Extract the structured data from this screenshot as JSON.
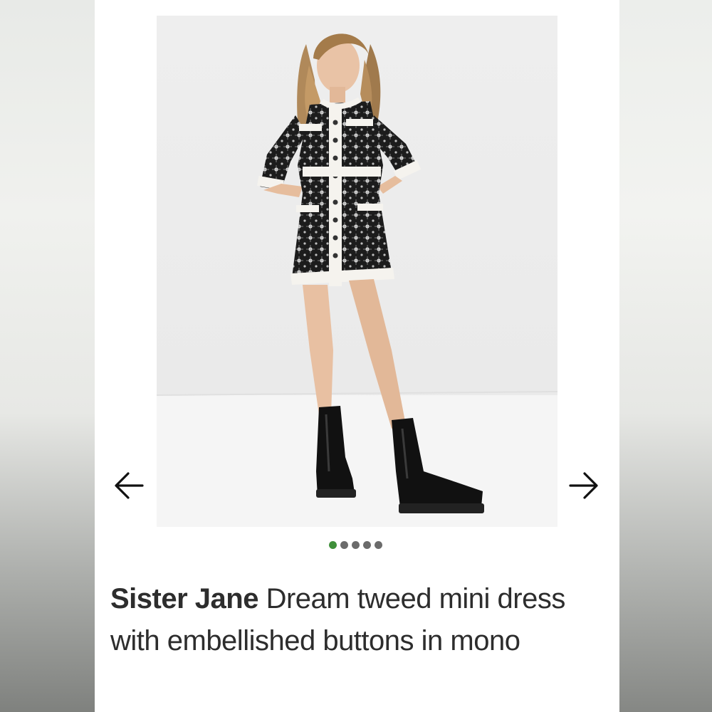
{
  "product": {
    "brand": "Sister Jane",
    "name": "Dream tweed mini dress with embellished buttons in mono"
  },
  "carousel": {
    "slide_count": 5,
    "active_index": 0,
    "active_color": "#3f8f3a",
    "inactive_color": "#6b6b6b",
    "prev_icon": "arrow-left-icon",
    "next_icon": "arrow-right-icon"
  }
}
